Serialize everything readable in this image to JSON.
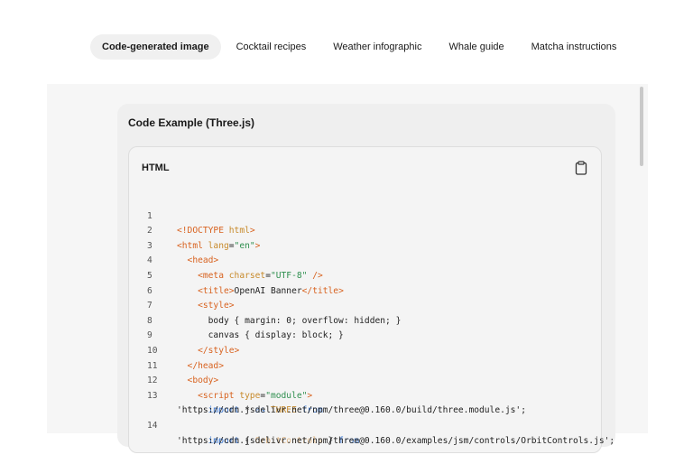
{
  "tabs": [
    {
      "label": "Code-generated image",
      "active": true
    },
    {
      "label": "Cocktail recipes",
      "active": false
    },
    {
      "label": "Weather infographic",
      "active": false
    },
    {
      "label": "Whale guide",
      "active": false
    },
    {
      "label": "Matcha instructions",
      "active": false
    }
  ],
  "card": {
    "title": "Code Example (Three.js)"
  },
  "code_block": {
    "language": "HTML",
    "copy_icon": "clipboard-icon",
    "line_numbers": [
      "1",
      "2",
      "3",
      "4",
      "5",
      "6",
      "7",
      "8",
      "9",
      "10",
      "11",
      "12",
      "13",
      "14"
    ],
    "lines": [
      [
        "<!DOCTYPE ",
        "html",
        ">"
      ],
      [
        "<html ",
        "lang",
        "=",
        "\"en\"",
        ">"
      ],
      [
        "  <head>"
      ],
      [
        "    <meta ",
        "charset",
        "=",
        "\"UTF-8\"",
        " />"
      ],
      [
        "    <title>",
        "OpenAI Banner",
        "</title>"
      ],
      [
        "    <style>"
      ],
      [
        "      body { margin: 0; overflow: hidden; }"
      ],
      [
        "      canvas { display: block; }"
      ],
      [
        "    </style>"
      ],
      [
        "  </head>"
      ],
      [
        "  <body>"
      ],
      [
        "    <script ",
        "type",
        "=",
        "\"module\"",
        ">"
      ],
      [
        "      import",
        " * ",
        "as",
        " THREE ",
        "from"
      ],
      [
        "      import",
        " { ",
        "OrbitControls",
        " } ",
        "from"
      ]
    ],
    "wrapped": {
      "13": "'https://cdn.jsdelivr.net/npm/three@0.160.0/build/three.module.js';",
      "14": "'https://cdn.jsdelivr.net/npm/three@0.160.0/examples/jsm/controls/OrbitControls.js';"
    }
  }
}
